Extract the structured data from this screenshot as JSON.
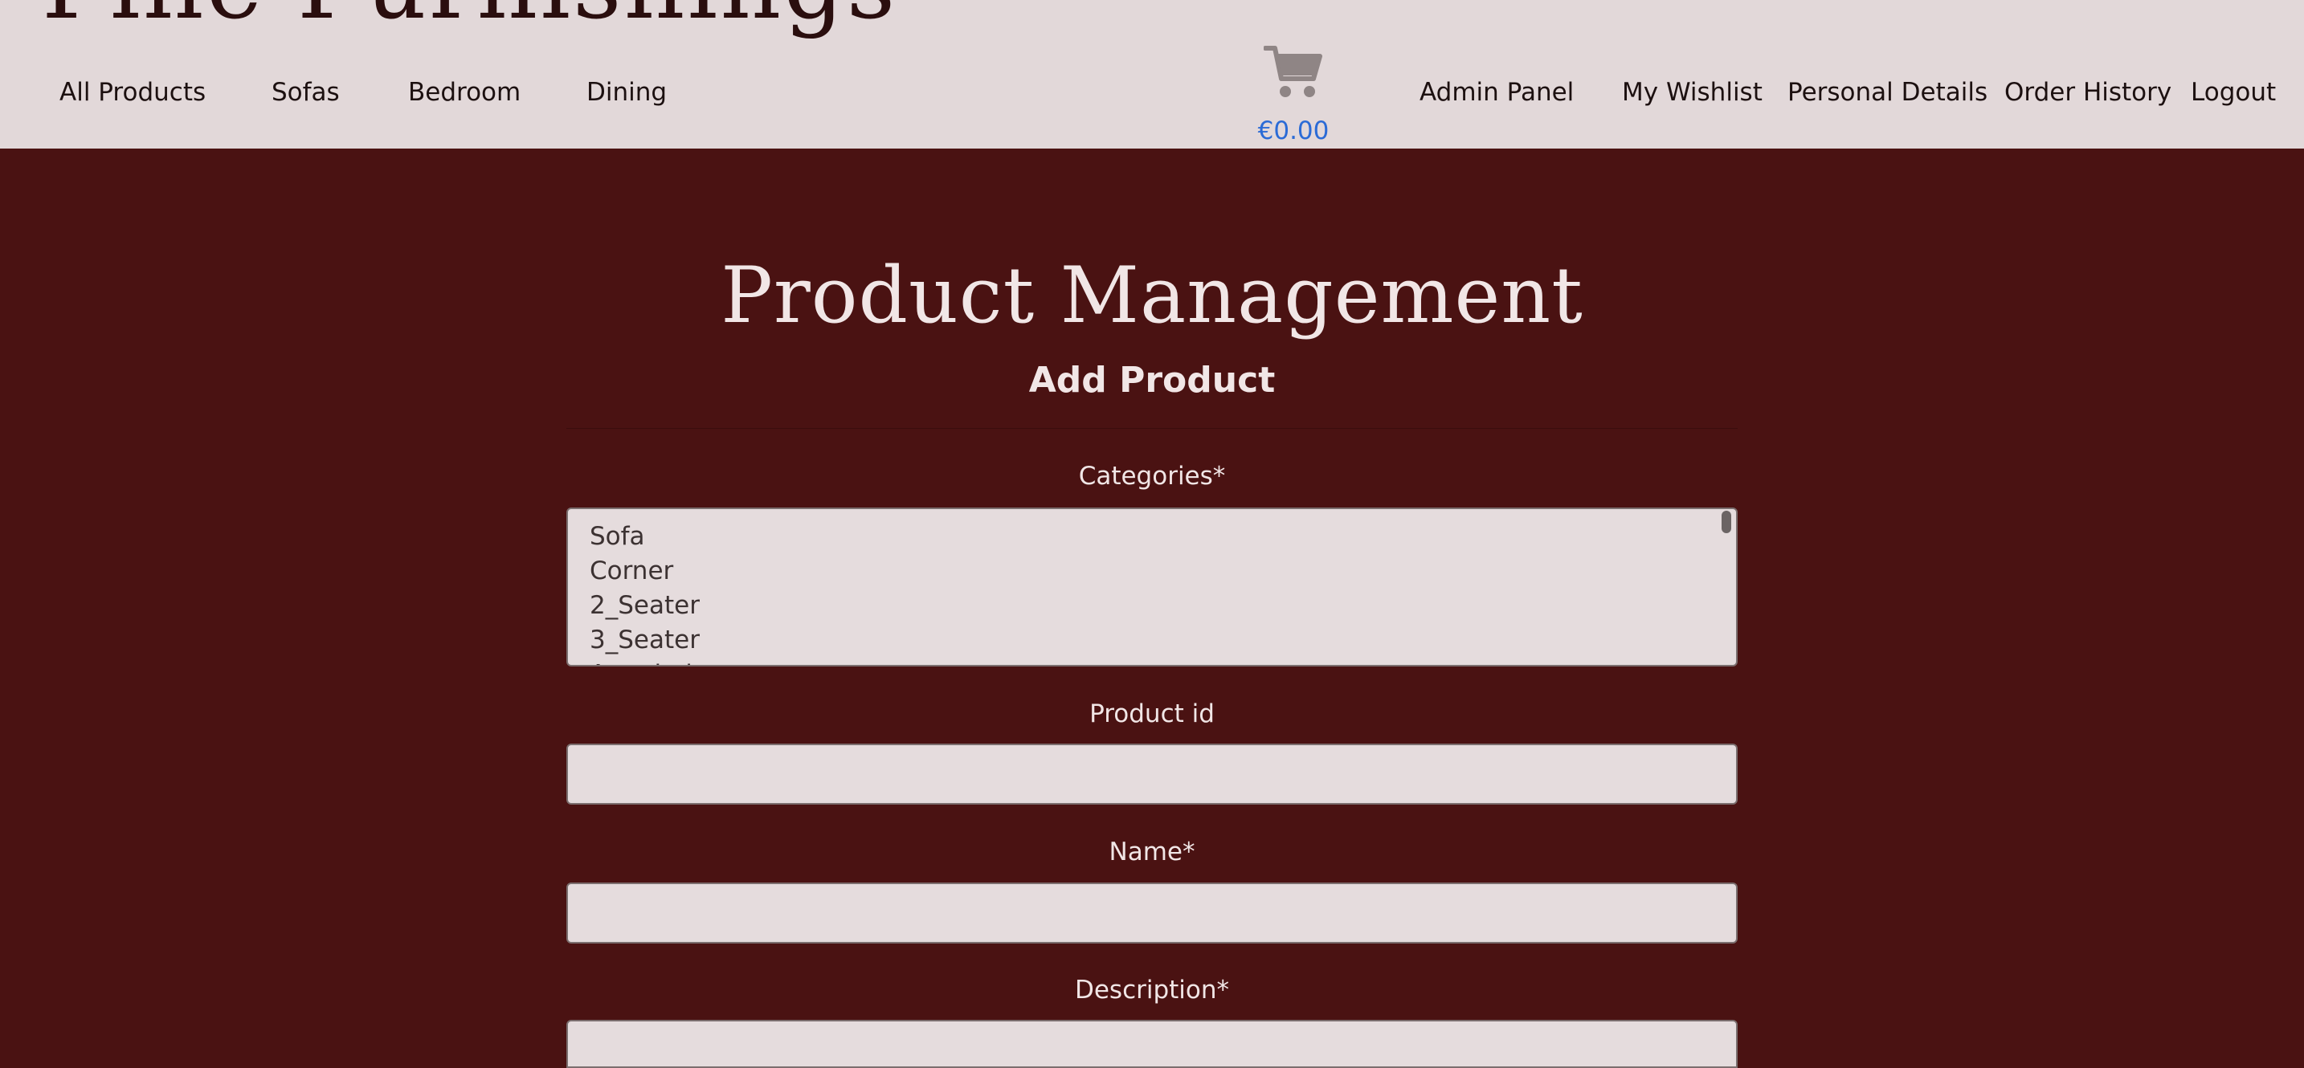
{
  "header": {
    "brand": "Fine Furnishings",
    "nav_left": [
      {
        "label": "All Products"
      },
      {
        "label": "Sofas"
      },
      {
        "label": "Bedroom"
      },
      {
        "label": "Dining"
      }
    ],
    "cart": {
      "icon": "cart-icon",
      "total": "€0.00"
    },
    "nav_right": [
      {
        "label": "Admin Panel"
      },
      {
        "label": "My Wishlist"
      },
      {
        "label": "Personal Details"
      },
      {
        "label": "Order History"
      },
      {
        "label": "Logout"
      }
    ]
  },
  "main": {
    "title": "Product Management",
    "subtitle": "Add Product",
    "form": {
      "categories": {
        "label": "Categories*",
        "options": [
          "Sofa",
          "Corner",
          "2_Seater",
          "3_Seater",
          "Armchair"
        ]
      },
      "product_id": {
        "label": "Product id",
        "value": ""
      },
      "name": {
        "label": "Name*",
        "value": ""
      },
      "description": {
        "label": "Description*",
        "value": ""
      }
    }
  },
  "colors": {
    "header_bg": "#e2d8d9",
    "page_bg": "#4a1212",
    "cart_total": "#2b6bd6",
    "input_bg": "#e5dcdd"
  }
}
